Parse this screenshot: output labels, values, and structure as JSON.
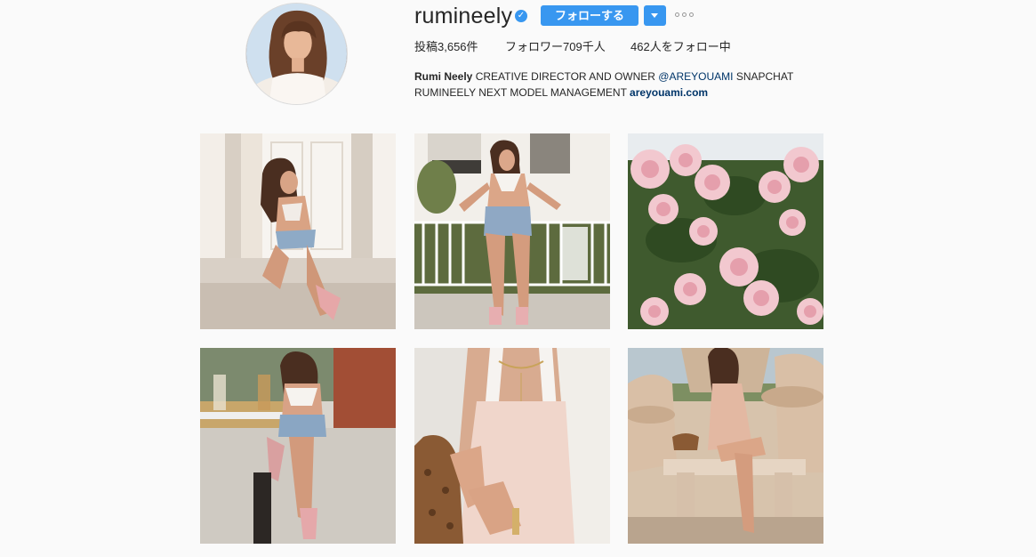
{
  "profile": {
    "username": "rumineely",
    "verified_icon": "verified-badge-icon",
    "follow_label": "フォローする",
    "stats": {
      "posts": "投稿3,656件",
      "followers": "フォロワー709千人",
      "following": "462人をフォロー中"
    },
    "bio": {
      "name": "Rumi Neely",
      "text1": " CREATIVE DIRECTOR AND OWNER ",
      "mention": "@AREYOUAMI",
      "text2": " SNAPCHAT",
      "line2": "RUMINEELY NEXT MODEL MANAGEMENT ",
      "link": "areyouami.com"
    }
  },
  "colors": {
    "accent": "#3897f0",
    "link": "#003569",
    "background": "#fafafa"
  },
  "posts": [
    {
      "subject": "woman seated on steps tying pink ribbon heels"
    },
    {
      "subject": "woman in white bralette and denim shorts by white fence"
    },
    {
      "subject": "pink roses"
    },
    {
      "subject": "woman seated at cafe table"
    },
    {
      "subject": "close-up of blush slip dress and necklace"
    },
    {
      "subject": "woman in blush dress by stone fountains"
    }
  ]
}
